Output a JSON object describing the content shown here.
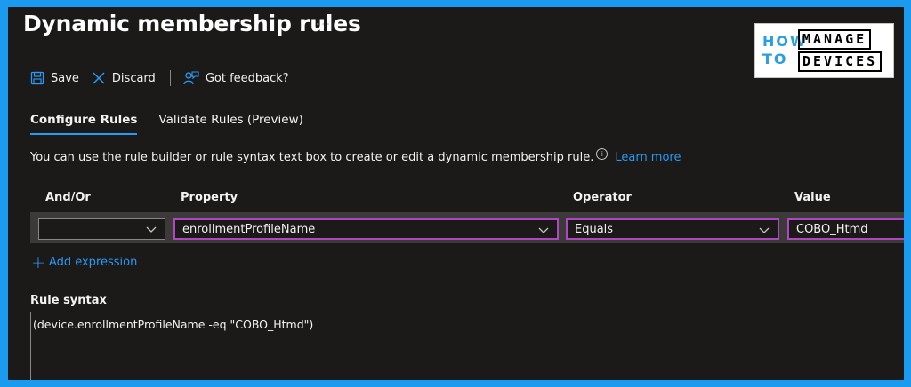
{
  "header": {
    "title": "Dynamic membership rules",
    "more": "..."
  },
  "logo": {
    "how": "HOW",
    "to": "TO",
    "manage": "MANAGE",
    "devices": "DEVICES"
  },
  "toolbar": {
    "save": "Save",
    "discard": "Discard",
    "feedback": "Got feedback?"
  },
  "tabs": [
    {
      "label": "Configure Rules",
      "active": true
    },
    {
      "label": "Validate Rules (Preview)",
      "active": false
    }
  ],
  "description": {
    "text": "You can use the rule builder or rule syntax text box to create or edit a dynamic membership rule.",
    "info": "i",
    "learn_more": "Learn more"
  },
  "columns": {
    "and_or": "And/Or",
    "property": "Property",
    "operator": "Operator",
    "value": "Value"
  },
  "rule_row": {
    "and_or": "",
    "property": "enrollmentProfileName",
    "operator": "Equals",
    "value": "COBO_Htmd"
  },
  "add_expression": "Add expression",
  "rule_syntax": {
    "label": "Rule syntax",
    "value": "(device.enrollmentProfileName -eq \"COBO_Htmd\")"
  },
  "colors": {
    "accent": "#2899f5",
    "highlight": "#b146c2",
    "frame": "#1b9bf0",
    "background": "#1b1a19"
  }
}
